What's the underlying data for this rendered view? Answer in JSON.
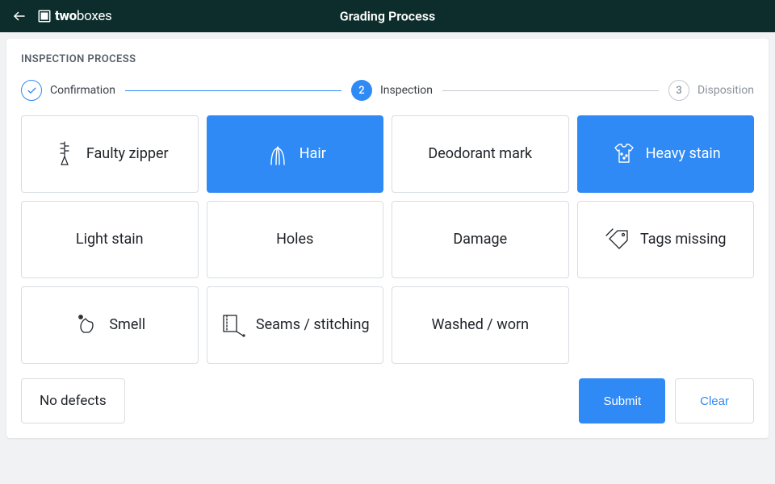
{
  "header": {
    "brand_bold": "two",
    "brand_light": "boxes",
    "title": "Grading Process"
  },
  "section_title": "INSPECTION PROCESS",
  "steps": [
    {
      "label": "Confirmation",
      "state": "done",
      "indicator": "✓"
    },
    {
      "label": "Inspection",
      "state": "current",
      "indicator": "2"
    },
    {
      "label": "Disposition",
      "state": "upcoming",
      "indicator": "3"
    }
  ],
  "defects": [
    {
      "label": "Faulty zipper",
      "selected": false,
      "icon": "zipper"
    },
    {
      "label": "Hair",
      "selected": true,
      "icon": "hair"
    },
    {
      "label": "Deodorant mark",
      "selected": false,
      "icon": null
    },
    {
      "label": "Heavy stain",
      "selected": true,
      "icon": "shirt"
    },
    {
      "label": "Light stain",
      "selected": false,
      "icon": null
    },
    {
      "label": "Holes",
      "selected": false,
      "icon": null
    },
    {
      "label": "Damage",
      "selected": false,
      "icon": null
    },
    {
      "label": "Tags missing",
      "selected": false,
      "icon": "tag"
    },
    {
      "label": "Smell",
      "selected": false,
      "icon": "smell"
    },
    {
      "label": "Seams / stitching",
      "selected": false,
      "icon": "stitch"
    },
    {
      "label": "Washed / worn",
      "selected": false,
      "icon": null
    }
  ],
  "footer": {
    "no_defects": "No defects",
    "submit": "Submit",
    "clear": "Clear"
  },
  "colors": {
    "accent": "#2f8af5",
    "header_bg": "#0c2d2b"
  }
}
